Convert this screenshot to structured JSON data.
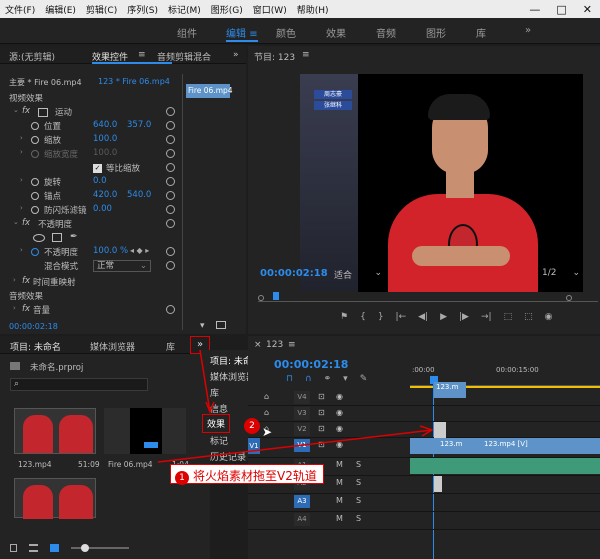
{
  "menubar": {
    "items": [
      "文件(F)",
      "编辑(E)",
      "剪辑(C)",
      "序列(S)",
      "标记(M)",
      "图形(G)",
      "窗口(W)",
      "帮助(H)"
    ],
    "minimize": "—",
    "maximize": "□",
    "close": "✕"
  },
  "workspaces": {
    "items": [
      "组件",
      "编辑",
      "颜色",
      "效果",
      "音频",
      "图形",
      "库"
    ],
    "active": "编辑",
    "menu_icon": "≡",
    "more": "»"
  },
  "effect_controls": {
    "tabs": [
      "源:(无剪辑)",
      "效果控件",
      "音频剪辑混合"
    ],
    "tab_menu": "≡",
    "tab_more": "»",
    "master": "主要 * Fire 06.mp4",
    "sequence": "123 * Fire 06.mp4",
    "mini_clip": "Fire 06.mp4",
    "section_video": "视频效果",
    "motion": "运动",
    "position_label": "位置",
    "position_x": "640.0",
    "position_y": "357.0",
    "scale_label": "缩放",
    "scale_value": "100.0",
    "scale_width_label": "缩放宽度",
    "scale_width_value": "100.0",
    "uniform_scale": "等比缩放",
    "rotation_label": "旋转",
    "rotation_value": "0.0",
    "anchor_label": "锚点",
    "anchor_x": "420.0",
    "anchor_y": "540.0",
    "flicker_label": "防闪烁滤镜",
    "flicker_value": "0.00",
    "opacity_section": "不透明度",
    "opacity_label": "不透明度",
    "opacity_value": "100.0 %",
    "blend_label": "混合模式",
    "blend_value": "正常",
    "time_remap": "时间重映射",
    "section_audio": "音频效果",
    "volume": "音量",
    "timecode": "00:00:02:18",
    "fx": "fx"
  },
  "program_monitor": {
    "title": "节目: 123",
    "menu_icon": "≡",
    "overlay_name1": "周志豪",
    "overlay_name2": "张继科",
    "timecode": "00:00:02:18",
    "fit": "适合",
    "quality": "1/2",
    "controls": [
      "⚑",
      "{",
      "}",
      "|←",
      "◀|",
      "▶",
      "|▶",
      "→|",
      "⬚",
      "⬚",
      "◉"
    ]
  },
  "project": {
    "tabs": [
      "项目: 未命名",
      "媒体浏览器",
      "库"
    ],
    "more": "»",
    "file": "未命名.prproj",
    "items": [
      {
        "name": "123.mp4",
        "duration": "51:09"
      },
      {
        "name": "Fire 06.mp4",
        "duration": "1:04"
      }
    ]
  },
  "dropdown": {
    "items": [
      "项目: 未命名",
      "媒体浏览器",
      "库",
      "信息",
      "效果",
      "标记",
      "历史记录"
    ]
  },
  "timeline": {
    "tab": "123",
    "menu_icon": "≡",
    "timecode": "00:00:02:18",
    "ruler": [
      ":00:00",
      "00:00:15:00"
    ],
    "video_tracks": [
      "V4",
      "V3",
      "V2",
      "V1"
    ],
    "audio_tracks": [
      "A1",
      "A2",
      "A3",
      "A4"
    ],
    "clips": {
      "v4": "123.m",
      "v1a": "123.m",
      "v1b": "123.mp4 [V]"
    },
    "s_label": "S",
    "m_label": "M"
  },
  "annotations": {
    "step1_num": "1",
    "step1_text": "将火焰素材拖至V2轨道",
    "step2_num": "2"
  },
  "colors": {
    "accent": "#2d8ceb",
    "annotation": "#dd0000",
    "clip_video": "#5d93c8",
    "clip_audio": "#3f9a7a"
  }
}
